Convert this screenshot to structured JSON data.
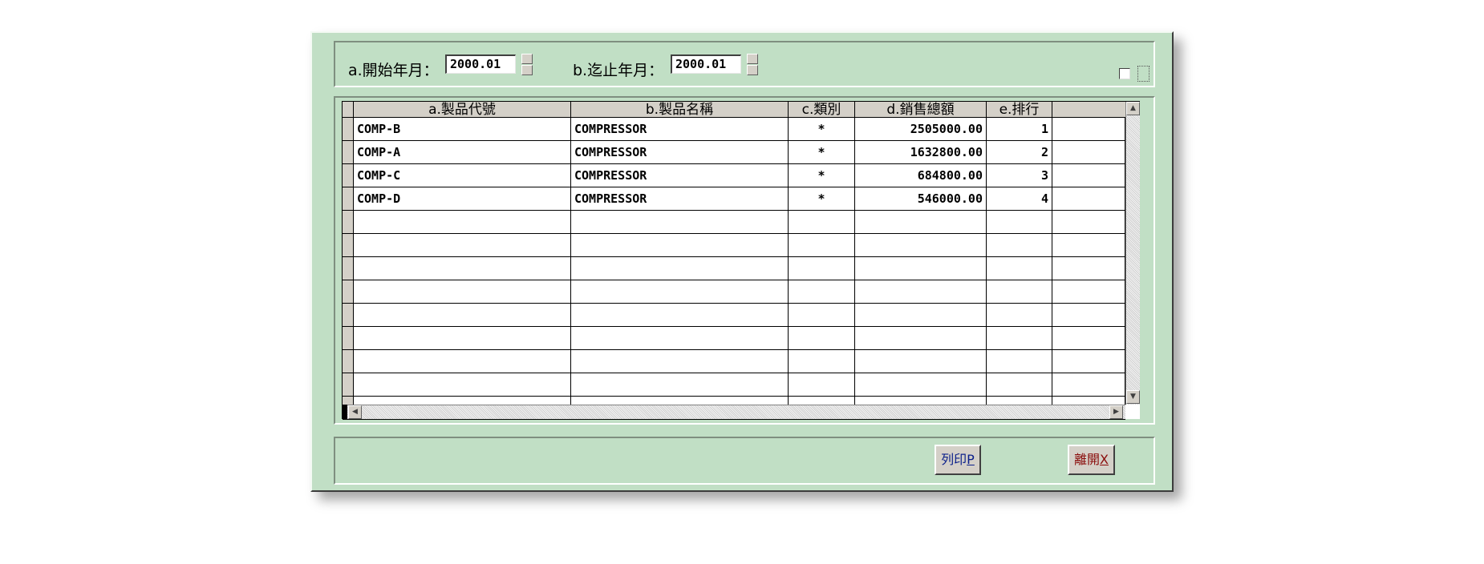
{
  "filters": {
    "start_label": "a.開始年月：",
    "start_value": "2000.01",
    "end_label": "b.迄止年月：",
    "end_value": "2000.01"
  },
  "grid": {
    "columns": [
      "a.製品代號",
      "b.製品名稱",
      "c.類別",
      "d.銷售總額",
      "e.排行"
    ],
    "rows": [
      [
        "COMP-B",
        "COMPRESSOR",
        "*",
        "2505000.00",
        "1"
      ],
      [
        "COMP-A",
        "COMPRESSOR",
        "*",
        "1632800.00",
        "2"
      ],
      [
        "COMP-C",
        "COMPRESSOR",
        "*",
        "684800.00",
        "3"
      ],
      [
        "COMP-D",
        "COMPRESSOR",
        "*",
        "546000.00",
        "4"
      ]
    ]
  },
  "buttons": {
    "print_label": "列印",
    "print_accel": "P",
    "exit_label": "離開",
    "exit_accel": "X"
  }
}
